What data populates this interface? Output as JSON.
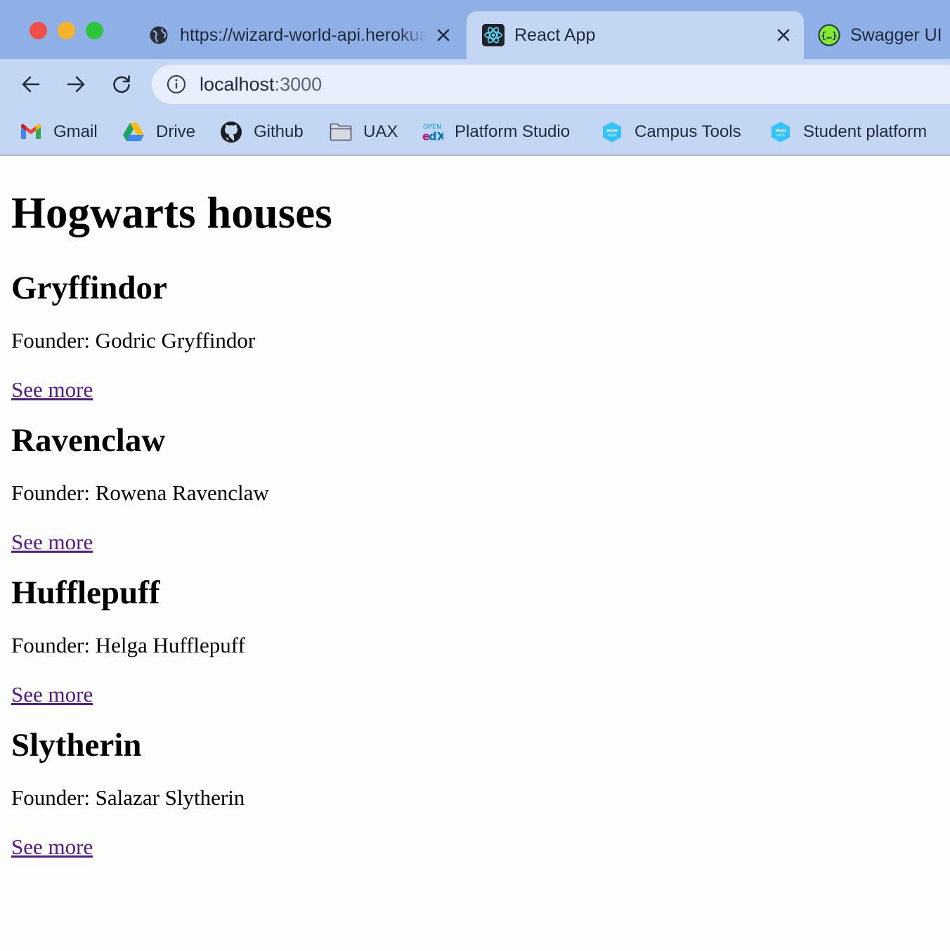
{
  "browser": {
    "tabs": [
      {
        "title": "https://wizard-world-api.herokuapp.com",
        "icon": "globe-icon",
        "active": false
      },
      {
        "title": "React App",
        "icon": "react-logo-icon",
        "active": true
      },
      {
        "title": "Swagger UI",
        "icon": "swagger-logo-icon",
        "active": false
      }
    ],
    "address": {
      "host": "localhost",
      "port": ":3000"
    },
    "bookmarks": [
      {
        "label": "Gmail",
        "icon": "gmail-icon"
      },
      {
        "label": "Drive",
        "icon": "google-drive-icon"
      },
      {
        "label": "Github",
        "icon": "github-icon"
      },
      {
        "label": "UAX",
        "icon": "folder-icon"
      },
      {
        "label": "Platform Studio",
        "icon": "open-edx-icon"
      },
      {
        "label": "Campus Tools",
        "icon": "ironhack-icon"
      },
      {
        "label": "Student platform",
        "icon": "ironhack-icon"
      }
    ],
    "colors": {
      "tabstrip": "#8fb0e6",
      "toolbar": "#c3d6f3",
      "omnibox": "#e8eefb"
    }
  },
  "page": {
    "title": "Hogwarts houses",
    "houses": [
      {
        "name": "Gryffindor",
        "founder": "Founder: Godric Gryffindor",
        "link": "See more"
      },
      {
        "name": "Ravenclaw",
        "founder": "Founder: Rowena Ravenclaw",
        "link": "See more"
      },
      {
        "name": "Hufflepuff",
        "founder": "Founder: Helga Hufflepuff",
        "link": "See more"
      },
      {
        "name": "Slytherin",
        "founder": "Founder: Salazar Slytherin",
        "link": "See more"
      }
    ],
    "colors": {
      "link": "#551a8b"
    }
  }
}
